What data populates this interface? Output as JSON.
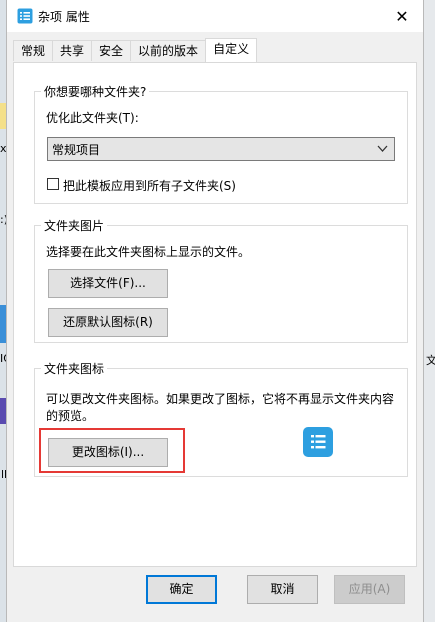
{
  "window": {
    "title": "杂项 属性",
    "close_glyph": "✕",
    "icon": "list-folder-icon"
  },
  "tabs": [
    "常规",
    "共享",
    "安全",
    "以前的版本",
    "自定义"
  ],
  "active_tab_index": 4,
  "folder_type": {
    "legend": "你想要哪种文件夹?",
    "optimize_label": "优化此文件夹(T):",
    "selected": "常规项目",
    "apply_subfolders_label": "把此模板应用到所有子文件夹(S)",
    "apply_subfolders_checked": false
  },
  "folder_picture": {
    "legend": "文件夹图片",
    "description": "选择要在此文件夹图标上显示的文件。",
    "choose_file_button": "选择文件(F)...",
    "restore_default_button": "还原默认图标(R)"
  },
  "folder_icon": {
    "legend": "文件夹图标",
    "description_line1": "可以更改文件夹图标。如果更改了图标，它将不再显示文件夹内容",
    "description_line2": "的预览。",
    "change_icon_button": "更改图标(I)..."
  },
  "footer": {
    "ok": "确定",
    "cancel": "取消",
    "apply": "应用(A)"
  },
  "background_peek": {
    "left_1": "x",
    "left_2": ":)",
    "right_1": "文",
    "left_3": "IO",
    "left_4": "ll"
  },
  "colors": {
    "accent": "#0078d7",
    "highlight": "#e53935",
    "folder_icon_bg": "#2d9fe0"
  }
}
